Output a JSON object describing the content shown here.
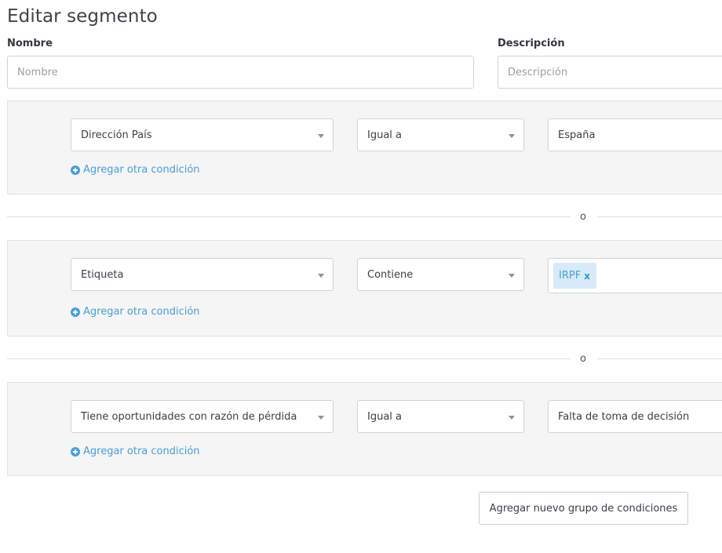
{
  "page": {
    "title": "Editar segmento"
  },
  "form": {
    "name": {
      "label": "Nombre",
      "placeholder": "Nombre",
      "value": ""
    },
    "description": {
      "label": "Descripción",
      "placeholder": "Descripción",
      "value": ""
    }
  },
  "groups": [
    {
      "conditions": [
        {
          "field": "Dirección País",
          "operator": "Igual a",
          "value": "España"
        }
      ],
      "add_condition_label": "Agregar otra condición"
    },
    {
      "conditions": [
        {
          "field": "Etiqueta",
          "operator": "Contiene",
          "tags": [
            {
              "label": "IRPF",
              "remove": "x"
            }
          ]
        }
      ],
      "add_condition_label": "Agregar otra condición"
    },
    {
      "conditions": [
        {
          "field": "Tiene oportunidades con razón de pérdida",
          "operator": "Igual a",
          "value": "Falta de toma de decisión"
        }
      ],
      "add_condition_label": "Agregar otra condición"
    }
  ],
  "dividers": [
    {
      "label": "o"
    },
    {
      "label": "o"
    }
  ],
  "actions": {
    "add_group_label": "Agregar nuevo grupo de condiciones"
  },
  "colors": {
    "link": "#4a9ed6",
    "tag_bg": "#d6ebf7",
    "group_bg": "#f5f5f5"
  }
}
